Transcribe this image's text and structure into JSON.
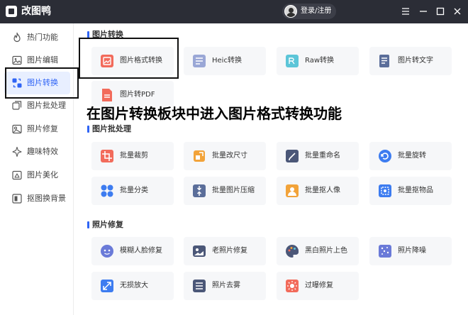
{
  "app": {
    "title": "改图鸭",
    "login_label": "登录/注册"
  },
  "sidebar": {
    "items": [
      {
        "label": "热门功能",
        "icon": "fire-icon"
      },
      {
        "label": "图片编辑",
        "icon": "image-edit-icon"
      },
      {
        "label": "图片转换",
        "icon": "image-convert-icon",
        "active": true
      },
      {
        "label": "图片批处理",
        "icon": "batch-icon"
      },
      {
        "label": "照片修复",
        "icon": "photo-repair-icon"
      },
      {
        "label": "趣味特效",
        "icon": "sparkle-icon"
      },
      {
        "label": "图片美化",
        "icon": "beautify-icon"
      },
      {
        "label": "抠图换背景",
        "icon": "cutout-icon"
      }
    ]
  },
  "sections": {
    "convert": {
      "title": "图片转换",
      "items": [
        {
          "label": "图片格式转换",
          "icon": "image-format-icon"
        },
        {
          "label": "Heic转换",
          "icon": "heic-icon"
        },
        {
          "label": "Raw转换",
          "icon": "raw-icon"
        },
        {
          "label": "图片转文字",
          "icon": "ocr-icon"
        },
        {
          "label": "图片转PDF",
          "icon": "pdf-icon"
        }
      ]
    },
    "batch": {
      "title": "图片批处理",
      "items": [
        {
          "label": "批量裁剪",
          "icon": "crop-icon"
        },
        {
          "label": "批量改尺寸",
          "icon": "resize-icon"
        },
        {
          "label": "批量重命名",
          "icon": "rename-icon"
        },
        {
          "label": "批量旋转",
          "icon": "rotate-icon"
        },
        {
          "label": "批量分类",
          "icon": "classify-icon"
        },
        {
          "label": "批量图片压缩",
          "icon": "compress-icon"
        },
        {
          "label": "批量抠人像",
          "icon": "portrait-cutout-icon"
        },
        {
          "label": "批量抠物品",
          "icon": "object-cutout-icon"
        }
      ]
    },
    "repair": {
      "title": "照片修复",
      "items": [
        {
          "label": "模糊人脸修复",
          "icon": "face-repair-icon"
        },
        {
          "label": "老照片修复",
          "icon": "old-photo-icon"
        },
        {
          "label": "黑白照片上色",
          "icon": "colorize-icon"
        },
        {
          "label": "照片降噪",
          "icon": "denoise-icon"
        },
        {
          "label": "无损放大",
          "icon": "upscale-icon"
        },
        {
          "label": "照片去雾",
          "icon": "dehaze-icon"
        },
        {
          "label": "过曝修复",
          "icon": "overexposure-icon"
        }
      ]
    }
  },
  "overlay_caption": "在图片转换板块中进入图片格式转换功能",
  "colors": {
    "titlebar": "#2b2d36",
    "accent": "#2f64f5",
    "card_bg": "#f6f7f9"
  }
}
